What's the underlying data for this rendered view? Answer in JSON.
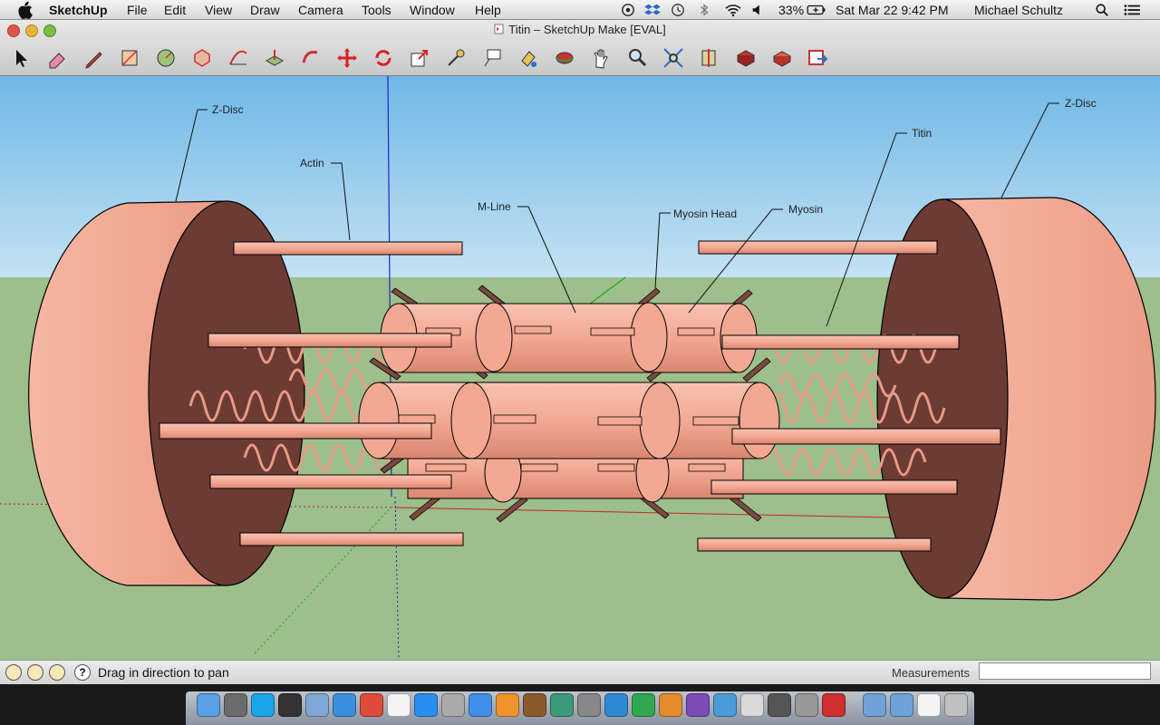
{
  "menubar": {
    "app_name": "SketchUp",
    "items": [
      "File",
      "Edit",
      "View",
      "Draw",
      "Camera",
      "Tools",
      "Window",
      "Help"
    ],
    "battery": "33%",
    "clock": "Sat Mar 22  9:42 PM",
    "user": "Michael Schultz"
  },
  "window": {
    "title": "Titin – SketchUp Make [EVAL]"
  },
  "toolbar": {
    "tools": [
      "select-tool",
      "eraser-tool",
      "pencil-tool",
      "rectangle-tool",
      "circle-tool",
      "polygon-tool",
      "arc-tool",
      "push-pull-tool",
      "follow-me-tool",
      "move-tool",
      "rotate-tool",
      "scale-tool",
      "tape-measure-tool",
      "text-tool",
      "paint-bucket-tool",
      "orbit-tool",
      "pan-tool",
      "zoom-tool",
      "zoom-extents-tool",
      "section-tool",
      "3d-warehouse-tool",
      "component-tool",
      "share-model-tool"
    ]
  },
  "model": {
    "labels": {
      "zdisc_left": "Z-Disc",
      "actin": "Actin",
      "mline": "M-Line",
      "myosin_head": "Myosin Head",
      "myosin": "Myosin",
      "titin": "Titin",
      "zdisc_right": "Z-Disc"
    },
    "colors": {
      "sky": "#8ec9ec",
      "ground": "#9cbf8c",
      "disc_face": "#f2a58f",
      "disc_inner": "#6b3b34",
      "filament": "#f3a893",
      "outline": "#000000"
    }
  },
  "statusbar": {
    "status_text": "Drag in direction to pan",
    "measurements_label": "Measurements",
    "measurements_value": ""
  }
}
